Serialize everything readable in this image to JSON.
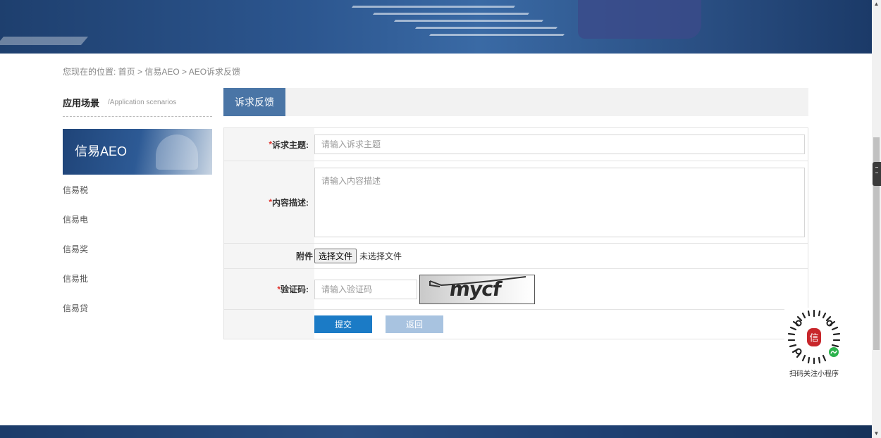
{
  "breadcrumb": "您现在的位置: 首页 > 信易AEO > AEO诉求反馈",
  "sidebar": {
    "title": "应用场景",
    "subtitle": "/Application scenarios",
    "active_item": "信易AEO",
    "items": [
      {
        "label": "信易税"
      },
      {
        "label": "信易电"
      },
      {
        "label": "信易奖"
      },
      {
        "label": "信易批"
      },
      {
        "label": "信易贷"
      }
    ]
  },
  "main": {
    "tab_label": "诉求反馈"
  },
  "form": {
    "subject": {
      "required_mark": "*",
      "label": "诉求主题:",
      "placeholder": "请输入诉求主题",
      "value": ""
    },
    "content": {
      "required_mark": "*",
      "label": "内容描述:",
      "placeholder": "请输入内容描述",
      "value": ""
    },
    "attachment": {
      "label": "附件",
      "button_label": "选择文件",
      "status": "未选择文件"
    },
    "captcha": {
      "required_mark": "*",
      "label": "验证码:",
      "placeholder": "请输入验证码",
      "image_text": "mycf"
    },
    "submit_label": "提交",
    "back_label": "返回"
  },
  "qr": {
    "caption": "扫码关注小程序",
    "center_glyph": "信"
  },
  "colors": {
    "primary": "#1b7bc6",
    "tab": "#4a75a6",
    "required": "#e0312b",
    "banner": "#2c568f"
  },
  "icons": {
    "qr": "qr-code-icon",
    "mini_program": "mini-program-icon"
  }
}
